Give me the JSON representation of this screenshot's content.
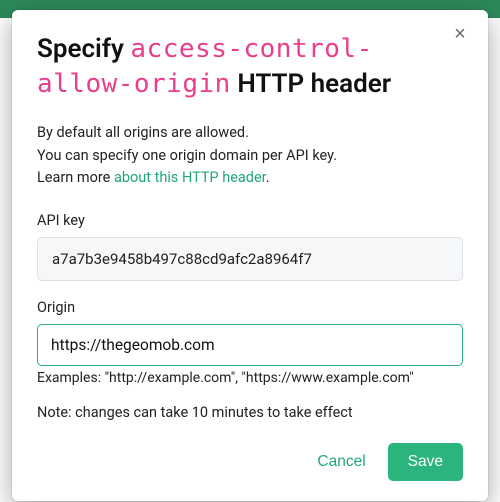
{
  "modal": {
    "title_prefix": "Specify",
    "title_code": "access-control-allow-origin",
    "title_suffix": "HTTP header",
    "close_glyph": "×",
    "description_line1": "By default all origins are allowed.",
    "description_line2": "You can specify one origin domain per API key.",
    "learn_more_prefix": "Learn more ",
    "learn_more_link": "about this HTTP header",
    "learn_more_suffix": ".",
    "api_key_label": "API key",
    "api_key_value": "a7a7b3e9458b497c88cd9afc2a8964f7",
    "origin_label": "Origin",
    "origin_value": "https://thegeomob.com",
    "examples_text": "Examples: \"http://example.com\", \"https://www.example.com\"",
    "note_text": "Note: changes can take 10 minutes to take effect",
    "cancel_label": "Cancel",
    "save_label": "Save"
  }
}
